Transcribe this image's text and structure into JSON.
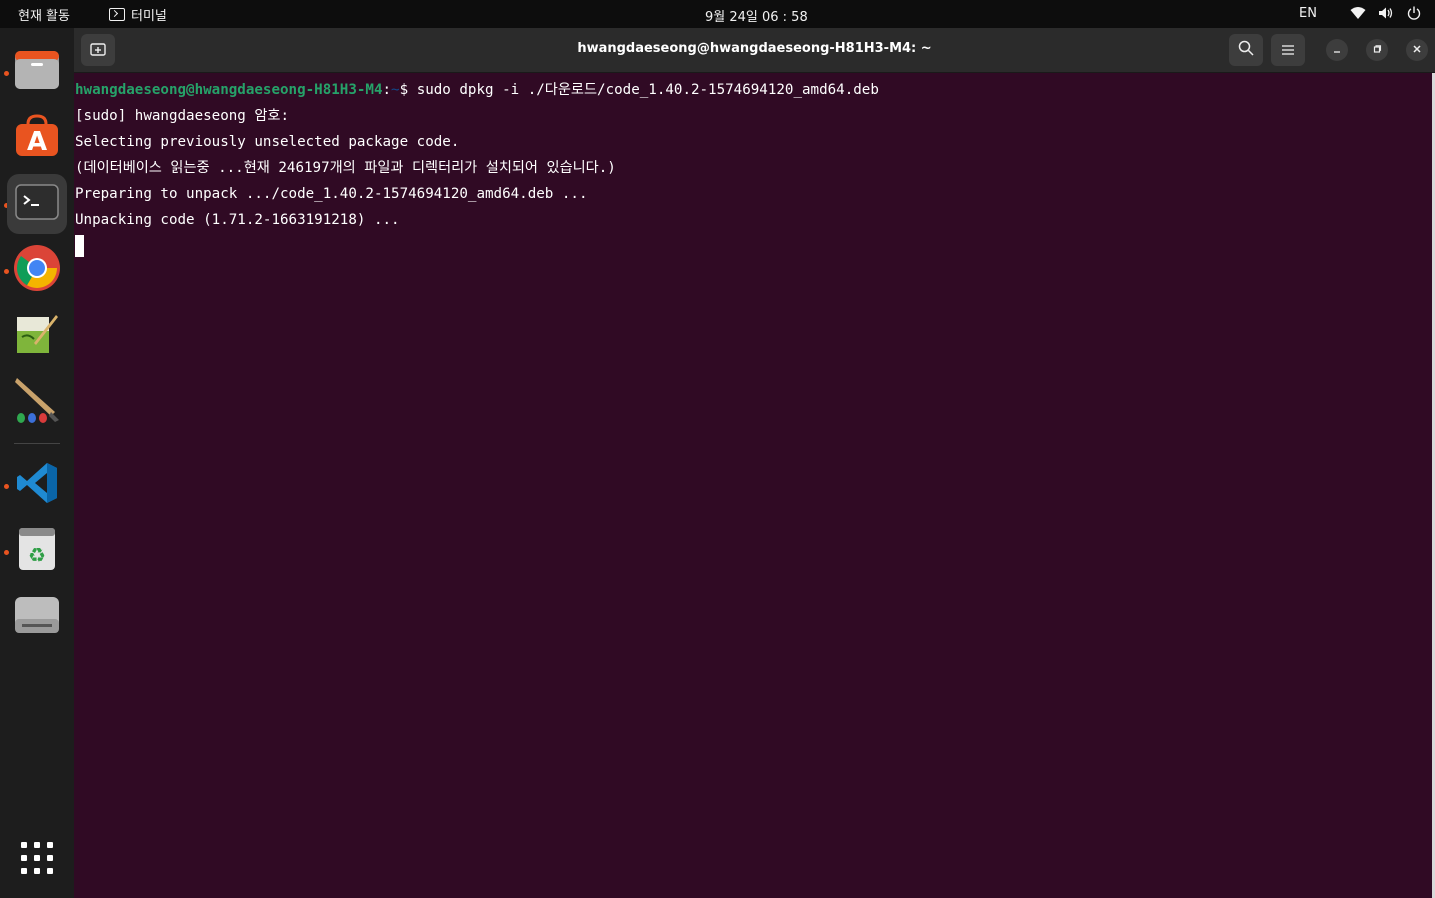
{
  "topbar": {
    "activities": "현재 활동",
    "app_name": "터미널",
    "clock": "9월 24일  06 : 58",
    "language": "EN"
  },
  "dock": {
    "apps": [
      {
        "name": "files",
        "icon": "files-icon",
        "running": true
      },
      {
        "name": "ubuntu-software",
        "icon": "app-store-icon",
        "running": false
      },
      {
        "name": "terminal",
        "icon": "terminal-icon",
        "running": true,
        "active": true
      },
      {
        "name": "chrome",
        "icon": "chrome-icon",
        "running": true
      },
      {
        "name": "gedit-like",
        "icon": "text-editor-icon",
        "running": false
      },
      {
        "name": "paint",
        "icon": "paintbrush-icon",
        "running": false
      },
      {
        "name": "vscode",
        "icon": "vscode-icon",
        "running": true
      },
      {
        "name": "trash",
        "icon": "trash-icon",
        "running": true
      },
      {
        "name": "drive",
        "icon": "drive-icon",
        "running": false
      }
    ],
    "show_apps_icon": "grid-icon"
  },
  "window": {
    "title": "hwangdaeseong@hwangdaeseong-H81H3-M4: ~"
  },
  "terminal": {
    "prompt_user": "hwangdaeseong@hwangdaeseong-H81H3-M4",
    "prompt_colon": ":",
    "prompt_path": "~",
    "prompt_dollar": "$ ",
    "command": "sudo dpkg -i ./다운로드/code_1.40.2-1574694120_amd64.deb",
    "output": [
      "[sudo] hwangdaeseong 암호:",
      "Selecting previously unselected package code.",
      "(데이터베이스 읽는중 ...현재 246197개의 파일과 디렉터리가 설치되어 있습니다.)",
      "Preparing to unpack .../code_1.40.2-1574694120_amd64.deb ...",
      "Unpacking code (1.71.2-1663191218) ..."
    ]
  },
  "colors": {
    "terminal_bg": "#300a24",
    "prompt_user": "#26a269",
    "prompt_path": "#12488b",
    "ubuntu_orange": "#e95420"
  }
}
